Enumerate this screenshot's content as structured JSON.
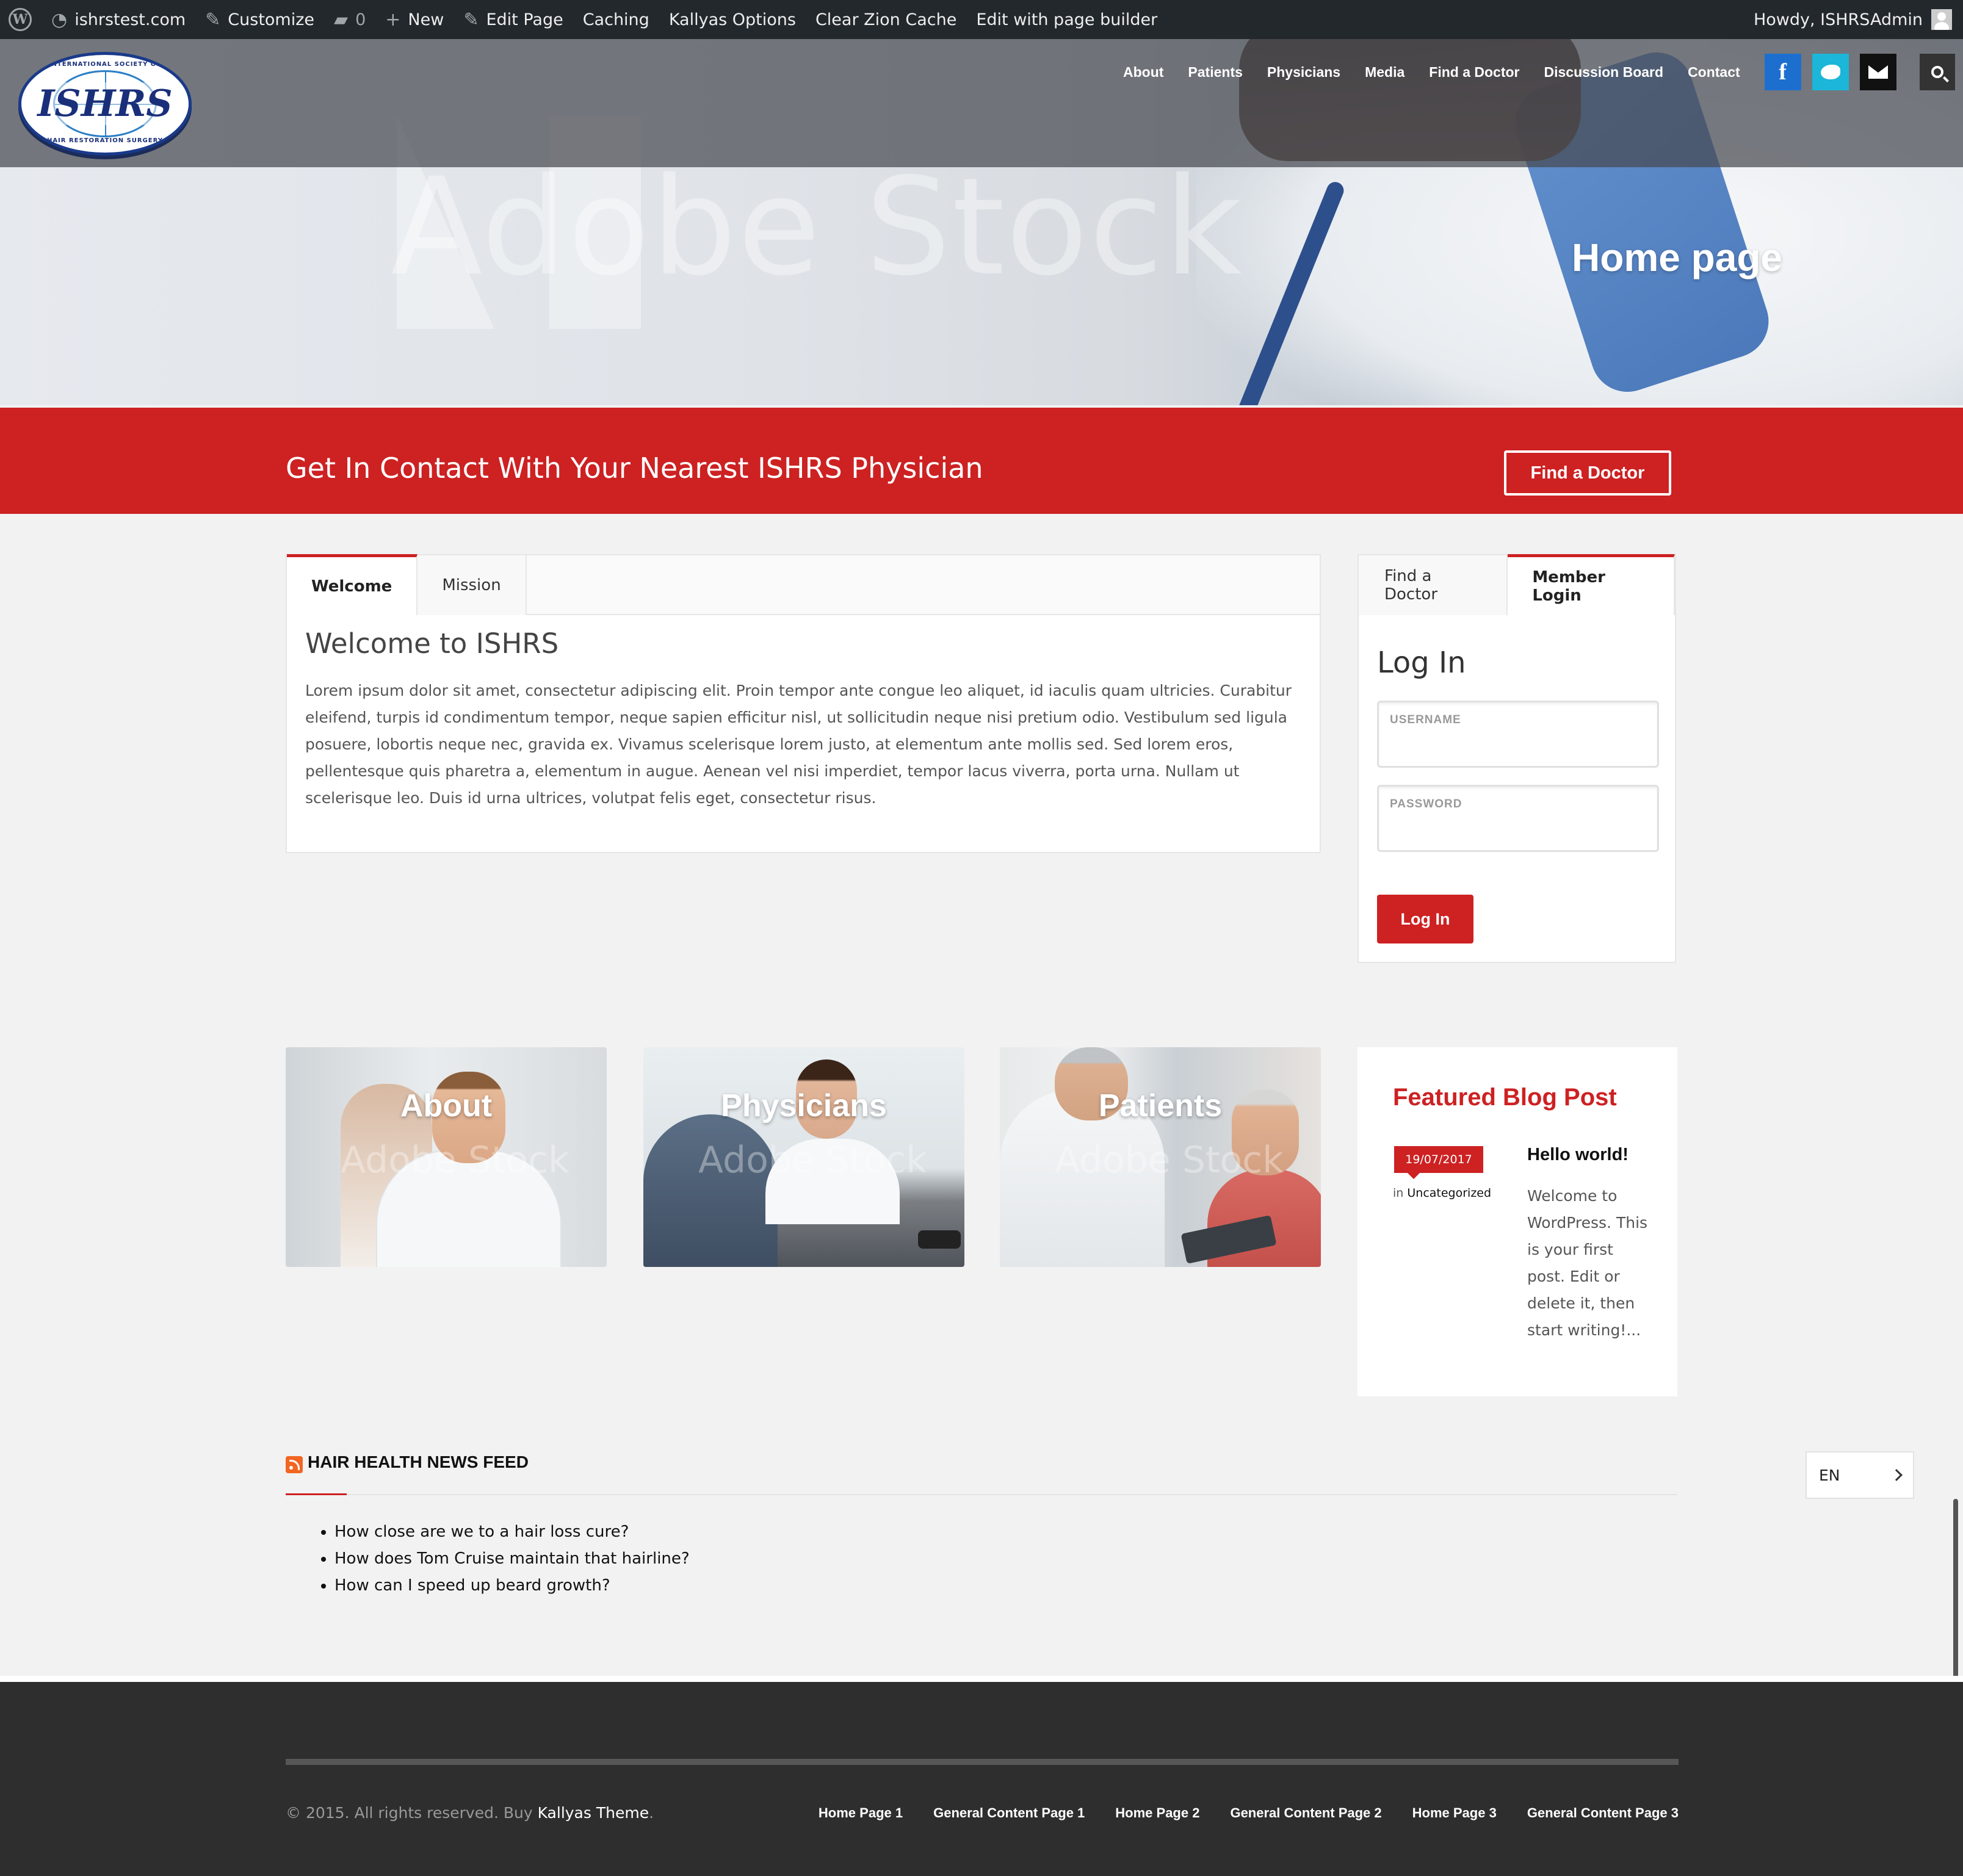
{
  "admin_bar": {
    "site_name": "ishrstest.com",
    "customize": "Customize",
    "comments_count": "0",
    "new": "New",
    "edit_page": "Edit Page",
    "caching": "Caching",
    "kallyas_options": "Kallyas Options",
    "clear_cache": "Clear Zion Cache",
    "page_builder": "Edit with page builder",
    "howdy": "Howdy, ISHRSAdmin"
  },
  "logo": {
    "text": "ISHRS",
    "ring_top": "INTERNATIONAL SOCIETY OF",
    "ring_bottom": "HAIR RESTORATION SURGERY"
  },
  "nav": {
    "items": [
      {
        "label": "About"
      },
      {
        "label": "Patients"
      },
      {
        "label": "Physicians"
      },
      {
        "label": "Media"
      },
      {
        "label": "Find a Doctor"
      },
      {
        "label": "Discussion Board"
      },
      {
        "label": "Contact"
      }
    ],
    "social": {
      "facebook": "f"
    }
  },
  "hero": {
    "title": "Home page",
    "watermark": "Adobe Stock"
  },
  "cta": {
    "text": "Get In Contact With Your Nearest ISHRS Physician",
    "button": "Find a Doctor"
  },
  "welcome": {
    "tabs": [
      {
        "label": "Welcome",
        "active": true
      },
      {
        "label": "Mission",
        "active": false
      }
    ],
    "title": "Welcome to ISHRS",
    "body": "Lorem ipsum dolor sit amet, consectetur adipiscing elit. Proin tempor ante congue leo aliquet, id iaculis quam ultricies. Curabitur eleifend, turpis id condimentum tempor, neque sapien efficitur nisl, ut sollicitudin neque nisi pretium odio. Vestibulum sed ligula posuere, lobortis neque nec, gravida ex. Vivamus scelerisque lorem justo, at elementum ante mollis sed. Sed lorem eros, pellentesque quis pharetra a, elementum in augue. Aenean vel nisi imperdiet, tempor lacus viverra, porta urna. Nullam ut scelerisque leo. Duis id urna ultrices, volutpat felis eget, consectetur risus."
  },
  "login": {
    "tabs": [
      {
        "label": "Find a Doctor",
        "active": false
      },
      {
        "label": "Member Login",
        "active": true
      }
    ],
    "title": "Log In",
    "username_label": "USERNAME",
    "username_value": "",
    "password_label": "PASSWORD",
    "password_value": "",
    "button": "Log In"
  },
  "image_boxes": [
    {
      "title": "About",
      "watermark": "Adobe Stock"
    },
    {
      "title": "Physicians",
      "watermark": "Adobe Stock"
    },
    {
      "title": "Patients",
      "watermark": "Adobe Stock"
    }
  ],
  "featured_blog": {
    "heading": "Featured Blog Post",
    "date": "19/07/2017",
    "category_prefix": "in",
    "category": "Uncategorized",
    "post_title": "Hello world!",
    "excerpt": "Welcome to WordPress. This is your first post. Edit or delete it, then start writing!..."
  },
  "news_feed": {
    "title": "HAIR HEALTH NEWS FEED",
    "items": [
      "How close are we to a hair loss cure?",
      "How does Tom Cruise maintain that hairline?",
      "How can I speed up beard growth?"
    ]
  },
  "language": {
    "selected": "EN"
  },
  "footer": {
    "copyright": "© 2015. All rights reserved. Buy",
    "theme_link": "Kallyas Theme",
    "copyright_end": ".",
    "menu": [
      "Home Page 1",
      "General Content Page 1",
      "Home Page 2",
      "General Content Page 2",
      "Home Page 3",
      "General Content Page 3"
    ]
  },
  "colors": {
    "accent": "#cd2122",
    "admin_bar": "#23282d",
    "footer": "#2e2e2e",
    "facebook": "#1d6fcf",
    "twitter": "#1bb6d8"
  }
}
